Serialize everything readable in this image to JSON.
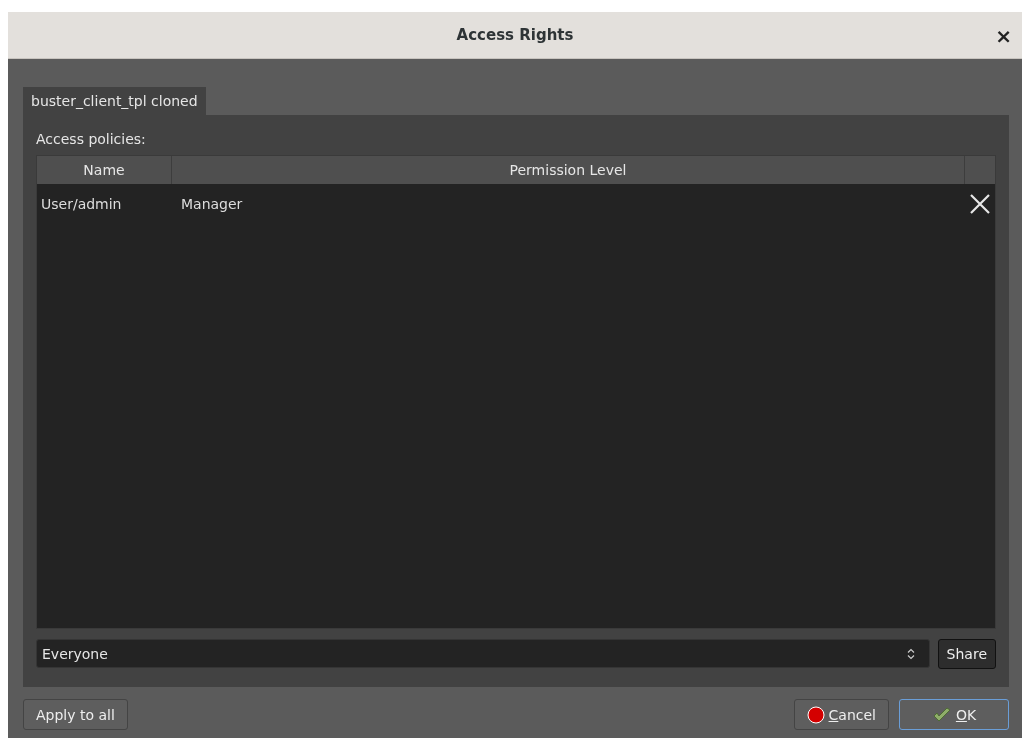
{
  "window": {
    "title": "Access Rights",
    "close": "×"
  },
  "tabs": [
    {
      "label": "buster_client_tpl cloned",
      "selected": true
    }
  ],
  "policies_label": "Access policies:",
  "table": {
    "columns": [
      "Name",
      "Permission Level"
    ],
    "rows": [
      {
        "name": "User/admin",
        "level": "Manager"
      }
    ]
  },
  "principal": {
    "value": "Everyone"
  },
  "share_button": "Share",
  "buttons": [
    {
      "label": "Apply to all",
      "kind": "plain"
    },
    {
      "label": "Cancel",
      "kind": "cancel"
    },
    {
      "label": "OK",
      "kind": "ok"
    }
  ]
}
